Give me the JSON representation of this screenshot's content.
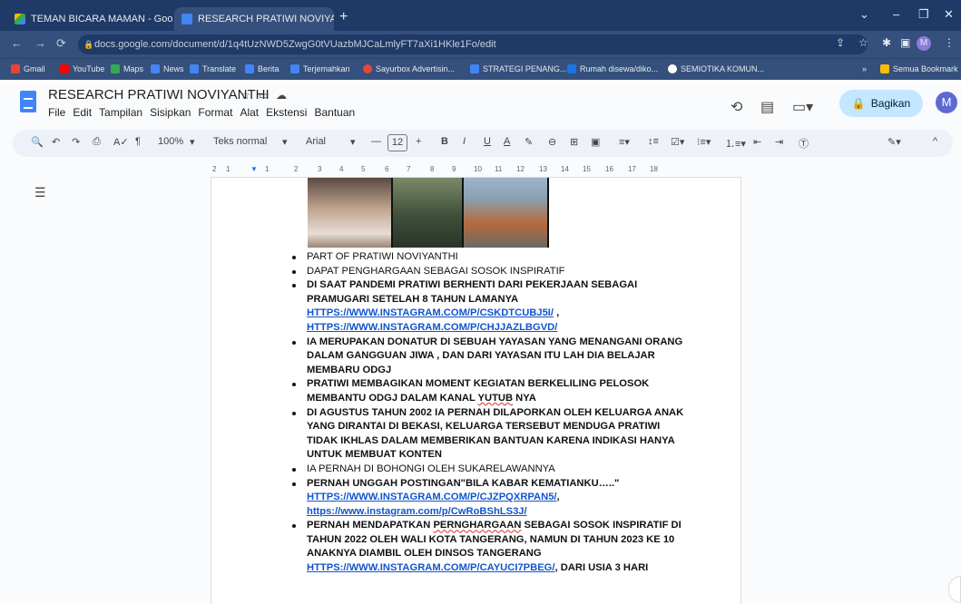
{
  "browser": {
    "tabs": [
      {
        "label": "TEMAN BICARA MAMAN - Goo",
        "icon": "drive-icon"
      },
      {
        "label": "RESEARCH PRATIWI NOVIYANTI",
        "icon": "docs-icon"
      }
    ],
    "url": "docs.google.com/document/d/1q4tUzNWD5ZwgG0tVUazbMJCaLmlyFT7aXi1HKle1Fo/edit",
    "bookmarks": [
      "Gmail",
      "YouTube",
      "Maps",
      "News",
      "Translate",
      "Berita",
      "Terjemahkan",
      "Sayurbox Advertisin...",
      "STRATEGI PENANG...",
      "Rumah disewa/diko...",
      "SEMIOTIKA KOMUN...",
      "Semua Bookmark"
    ],
    "profile": "M"
  },
  "docs": {
    "title": "RESEARCH PRATIWI NOVIYANTHI",
    "menu": [
      "File",
      "Edit",
      "Tampilan",
      "Sisipkan",
      "Format",
      "Alat",
      "Ekstensi",
      "Bantuan"
    ],
    "share_label": "Bagikan",
    "avatar": "M"
  },
  "toolbar": {
    "zoom": "100%",
    "style": "Teks normal",
    "font": "Arial",
    "size": "12"
  },
  "ruler": [
    "2",
    "1",
    "1",
    "2",
    "3",
    "4",
    "5",
    "6",
    "7",
    "8",
    "9",
    "10",
    "11",
    "12",
    "13",
    "14",
    "15",
    "16",
    "17",
    "18"
  ],
  "content": {
    "b1": "PART OF PRATIWI NOVIYANTHI",
    "b2": "DAPAT PENGHARGAAN SEBAGAI SOSOK INSPIRATIF",
    "b3": "DI SAAT PANDEMI PRATIWI BERHENTI DARI PEKERJAAN SEBAGAI PRAMUGARI SETELAH 8 TAHUN LAMANYA",
    "b3_link1": "HTTPS://WWW.INSTAGRAM.COM/P/CSKDTCUBJ5I/",
    "b3_sep": " ,",
    "b3_link2": "HTTPS://WWW.INSTAGRAM.COM/P/CHJJAZLBGVD/",
    "b4": "IA MERUPAKAN DONATUR DI SEBUAH YAYASAN YANG MENANGANI ORANG DALAM GANGGUAN JIWA , DAN DARI YAYASAN ITU LAH DIA BELAJAR MEMBARU ODGJ",
    "b5_a": "PRATIWI MEMBAGIKAN MOMENT KEGIATAN BERKELILING PELOSOK MEMBANTU ODGJ DALAM KANAL ",
    "b5_sq": "YUTUB",
    "b5_b": " NYA",
    "b6": "DI AGUSTUS TAHUN 2002 IA PERNAH DILAPORKAN OLEH KELUARGA ANAK YANG DIRANTAI DI BEKASI, KELUARGA TERSEBUT MENDUGA PRATIWI TIDAK IKHLAS DALAM MEMBERIKAN BANTUAN KARENA INDIKASI HANYA UNTUK MEMBUAT KONTEN",
    "b7": "IA PERNAH DI BOHONGI OLEH SUKARELAWANNYA",
    "b8": "PERNAH UNGGAH POSTINGAN\"BILA KABAR KEMATIANKU…..\"",
    "b8_link1": "HTTPS://WWW.INSTAGRAM.COM/P/CJZPQXRPAN5/",
    "b8_sep": ",",
    "b8_link2": "https://www.instagram.com/p/CwRoBShLS3J/",
    "b9_a": "PERNAH MENDAPATKAN ",
    "b9_sq": "PERNGHARGAAN",
    "b9_b": " SEBAGAI SOSOK INSPIRATIF DI TAHUN 2022 OLEH WALI KOTA TANGERANG, NAMUN DI TAHUN 2023 KE 10 ANAKNYA DIAMBIL OLEH DINSOS TANGERANG ",
    "b9_link": "HTTPS://WWW.INSTAGRAM.COM/P/CAYUCI7PBEG/",
    "b9_c": ", DARI USIA 3 HARI"
  }
}
